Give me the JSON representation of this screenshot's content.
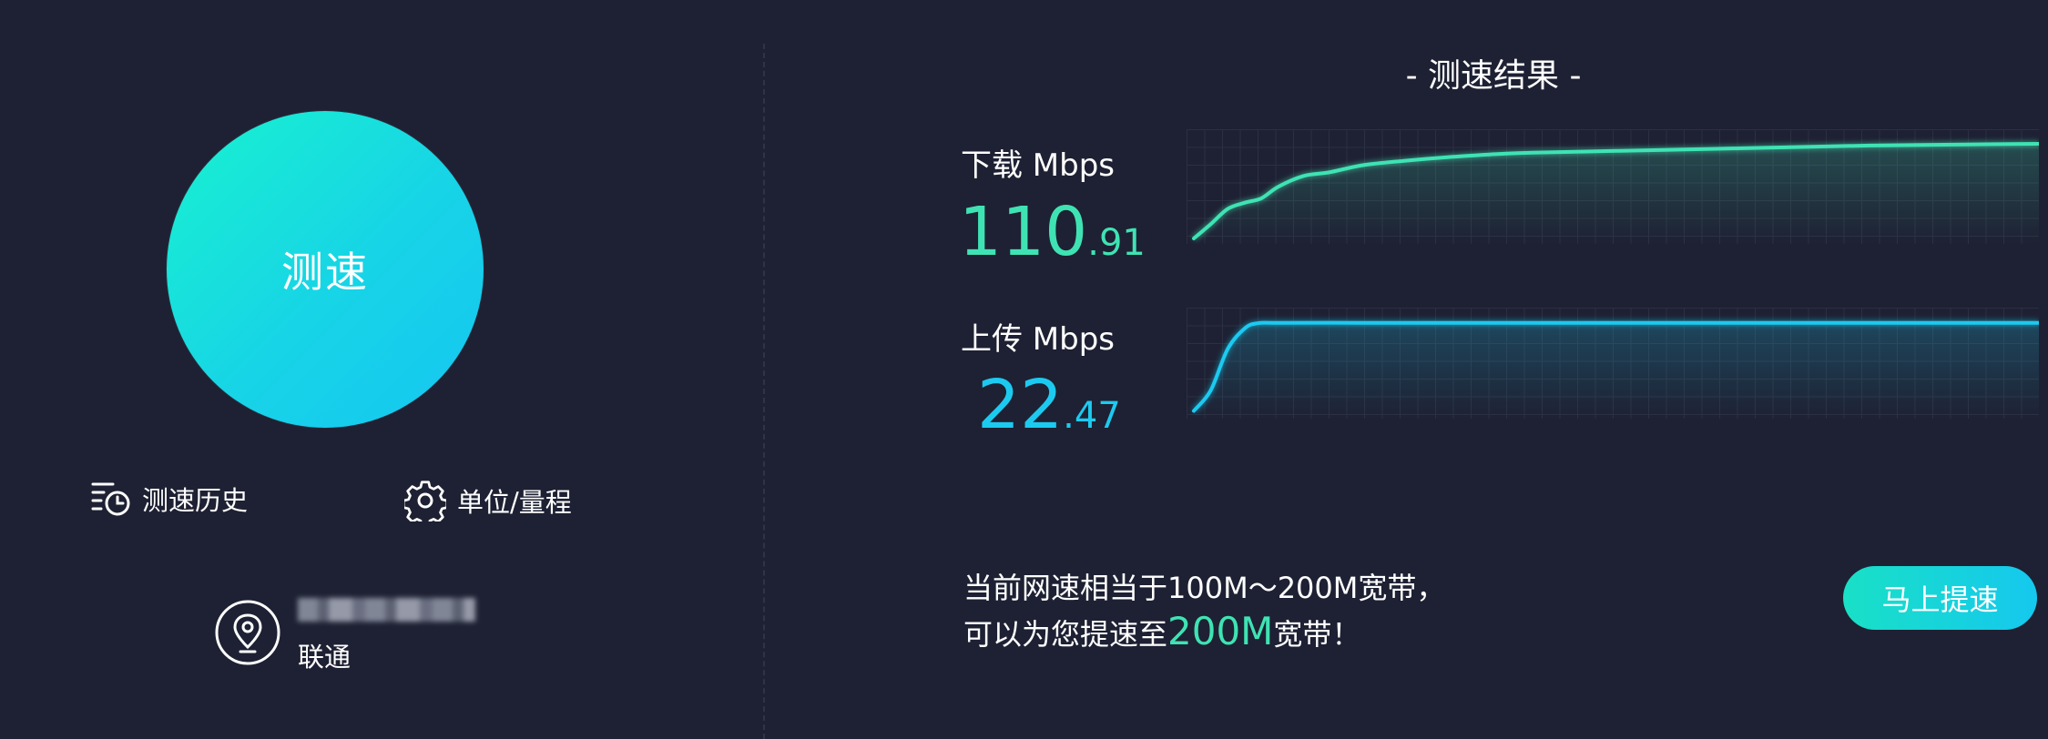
{
  "start": {
    "label": "测速"
  },
  "tools": {
    "history_label": "测速历史",
    "settings_label": "单位/量程"
  },
  "isp": {
    "name": "联通"
  },
  "results": {
    "title": "- 测速结果 -",
    "download": {
      "label": "下载 Mbps",
      "value_int": "110",
      "value_dec": ".91",
      "color": "#3fe3b3"
    },
    "upload": {
      "label": "上传 Mbps",
      "value_int": "22",
      "value_dec": ".47",
      "color": "#1ccaf0"
    }
  },
  "recommendation": {
    "line1": "当前网速相当于100M～200M宽带，",
    "line2_prefix": "可以为您提速至",
    "line2_highlight": "200M",
    "line2_suffix": "宽带！"
  },
  "boost": {
    "label": "马上提速"
  },
  "colors": {
    "background": "#1e2133",
    "accent_green": "#3fe3b3",
    "accent_blue": "#1ccaf0"
  },
  "chart_data": [
    {
      "type": "line",
      "x": [
        0,
        0.02,
        0.04,
        0.06,
        0.08,
        0.1,
        0.13,
        0.16,
        0.2,
        0.25,
        0.3,
        0.35,
        0.4,
        0.5,
        0.6,
        0.7,
        0.8,
        0.9,
        1.0
      ],
      "series": [
        {
          "values": [
            2,
            18,
            35,
            42,
            47,
            60,
            72,
            76,
            84,
            89,
            93,
            96,
            98,
            100,
            102,
            104,
            106,
            107,
            108
          ]
        }
      ],
      "ylim": [
        0,
        110
      ]
    },
    {
      "type": "line",
      "x": [
        0,
        0.02,
        0.04,
        0.06,
        0.075,
        0.1,
        0.2,
        0.3,
        0.4,
        0.5,
        0.6,
        0.7,
        0.8,
        0.9,
        1.0
      ],
      "series": [
        {
          "values": [
            1,
            6,
            16,
            21,
            22.3,
            22.4,
            22.4,
            22.4,
            22.4,
            22.4,
            22.4,
            22.4,
            22.4,
            22.4,
            22.4
          ]
        }
      ],
      "ylim": [
        0,
        23
      ]
    }
  ]
}
